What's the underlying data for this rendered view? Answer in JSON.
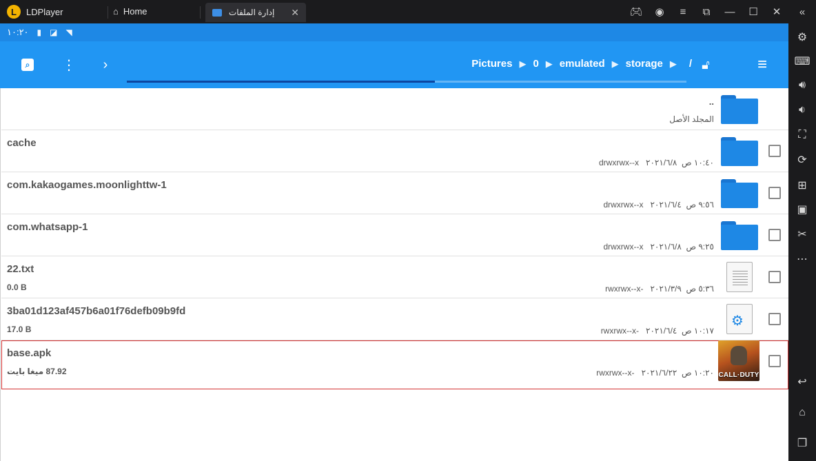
{
  "titlebar": {
    "app_name": "LDPlayer",
    "logo_glyph": "L",
    "home_tab": "Home",
    "active_tab": "إدارة الملفات",
    "actions": [
      "gamepad-icon",
      "user-icon",
      "menu-icon",
      "popout-icon",
      "minimize-icon",
      "maximize-icon",
      "close-icon",
      "collapse-icon"
    ]
  },
  "statusbar": {
    "time": "١٠:٢٠"
  },
  "toolbar": {
    "breadcrumbs": [
      "Pictures",
      "0",
      "emulated",
      "storage",
      "/"
    ],
    "progress_fraction": 0.55
  },
  "files": [
    {
      "type": "parent",
      "name": "..",
      "subtitle": "المجلد الأصل"
    },
    {
      "type": "folder",
      "name": "cache",
      "perms": "drwxrwx--x",
      "time": "١٠:٤٠ ص",
      "date": "٢٠٢١/٦/٨"
    },
    {
      "type": "folder",
      "name": "com.kakaogames.moonlighttw-1",
      "perms": "drwxrwx--x",
      "time": "٩:٥٦ ص",
      "date": "٢٠٢١/٦/٤"
    },
    {
      "type": "folder",
      "name": "com.whatsapp-1",
      "perms": "drwxrwx--x",
      "time": "٩:٢٥ ص",
      "date": "٢٠٢١/٦/٨"
    },
    {
      "type": "text",
      "name": "22.txt",
      "size": "0.0 B",
      "perms": "rwxrwx--x-",
      "time": "٥:٣٦ ص",
      "date": "٢٠٢١/٣/٩"
    },
    {
      "type": "binary",
      "name": "3ba01d123af457b6a01f76defb09b9fd",
      "size": "17.0 B",
      "perms": "rwxrwx--x-",
      "time": "١٠:١٧ ص",
      "date": "٢٠٢١/٦/٤"
    },
    {
      "type": "apk",
      "name": "base.apk",
      "size": "87.92 ميغا بايت",
      "perms": "rwxrwx--x-",
      "time": "١٠:٢٠ ص",
      "date": "٢٠٢١/٦/٢٢",
      "thumb_label": "CALL·DUTY"
    }
  ],
  "sidepanel": [
    "settings-icon",
    "keyboard-icon",
    "volume-up-icon",
    "volume-down-icon",
    "screenshot-icon",
    "rotate-icon",
    "add-window-icon",
    "apk-install-icon",
    "scissors-icon",
    "more-icon",
    "back-icon",
    "home-icon",
    "recents-icon"
  ]
}
